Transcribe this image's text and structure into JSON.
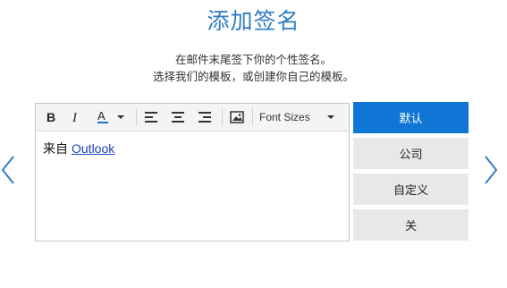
{
  "title": "添加签名",
  "subtitle": {
    "line1": "在邮件末尾签下你的个性签名。",
    "line2": "选择我们的模板，或创建你自己的模板。"
  },
  "toolbar": {
    "bold_icon": "bold-icon",
    "italic_icon": "italic-icon",
    "font_color_icon": "font-color-icon",
    "align_left_icon": "align-left-icon",
    "align_center_icon": "align-center-icon",
    "align_right_icon": "align-right-icon",
    "image_icon": "image-icon",
    "font_sizes_label": "Font Sizes"
  },
  "editor": {
    "text": "来自",
    "link": "Outlook"
  },
  "templates": [
    {
      "label": "默认",
      "active": true
    },
    {
      "label": "公司",
      "active": false
    },
    {
      "label": "自定义",
      "active": false
    },
    {
      "label": "关",
      "active": false
    }
  ],
  "colors": {
    "accent": "#0f76d6",
    "title": "#2e7cc5",
    "font_color_bar": "#1a6fd1"
  }
}
